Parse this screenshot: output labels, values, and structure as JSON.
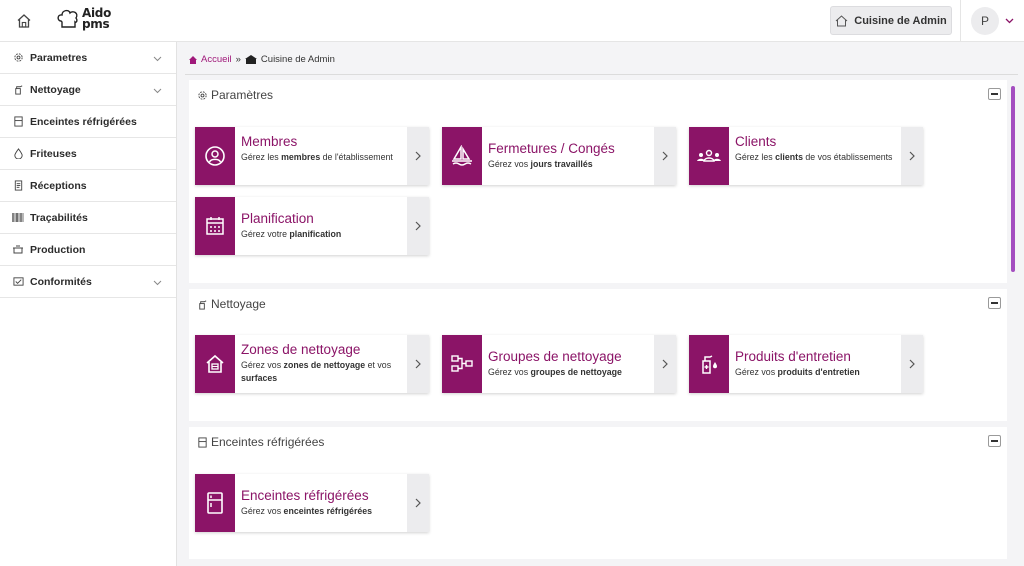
{
  "header": {
    "logo_line1": "Aido",
    "logo_line2": "pms",
    "site_button": "Cuisine de Admin",
    "user_initial": "P"
  },
  "sidebar": {
    "items": [
      {
        "label": "Parametres",
        "icon": "gear-icon",
        "chevron": true
      },
      {
        "label": "Nettoyage",
        "icon": "spray-icon",
        "chevron": true
      },
      {
        "label": "Enceintes réfrigérées",
        "icon": "fridge-icon",
        "chevron": false
      },
      {
        "label": "Friteuses",
        "icon": "drop-icon",
        "chevron": false
      },
      {
        "label": "Réceptions",
        "icon": "receipt-icon",
        "chevron": false
      },
      {
        "label": "Traçabilités",
        "icon": "barcode-icon",
        "chevron": false
      },
      {
        "label": "Production",
        "icon": "pot-icon",
        "chevron": false
      },
      {
        "label": "Conformités",
        "icon": "check-icon",
        "chevron": true
      }
    ]
  },
  "breadcrumb": {
    "home": "Accueil",
    "separator": "»",
    "current": "Cuisine de Admin"
  },
  "sections": {
    "parametres": {
      "title": "Paramètres",
      "cards": [
        {
          "title": "Membres",
          "desc_pre": "Gérez les ",
          "desc_bold": "membres",
          "desc_post": " de l'établissement"
        },
        {
          "title": "Fermetures / Congés",
          "desc_pre": "Gérez vos ",
          "desc_bold": "jours travaillés",
          "desc_post": ""
        },
        {
          "title": "Clients",
          "desc_pre": "Gérez les ",
          "desc_bold": "clients",
          "desc_post": " de vos établissements"
        },
        {
          "title": "Planification",
          "desc_pre": "Gérez votre ",
          "desc_bold": "planification",
          "desc_post": ""
        }
      ]
    },
    "nettoyage": {
      "title": "Nettoyage",
      "cards": [
        {
          "title": "Zones de nettoyage",
          "desc_pre": "Gérez vos ",
          "desc_bold": "zones de nettoyage",
          "desc_post": " et vos ",
          "desc_bold2": "surfaces"
        },
        {
          "title": "Groupes de nettoyage",
          "desc_pre": "Gérez vos ",
          "desc_bold": "groupes de nettoyage",
          "desc_post": ""
        },
        {
          "title": "Produits d'entretien",
          "desc_pre": "Gérez vos ",
          "desc_bold": "produits d'entretien",
          "desc_post": ""
        }
      ]
    },
    "enceintes": {
      "title": "Enceintes réfrigérées",
      "cards": [
        {
          "title": "Enceintes réfrigérées",
          "desc_pre": "Gérez vos ",
          "desc_bold": "enceintes réfrigérées",
          "desc_post": ""
        }
      ]
    }
  },
  "colors": {
    "brand": "#8b1467",
    "breadcrumb_link": "#a0197a",
    "card_arrow_bg": "#ececee"
  }
}
